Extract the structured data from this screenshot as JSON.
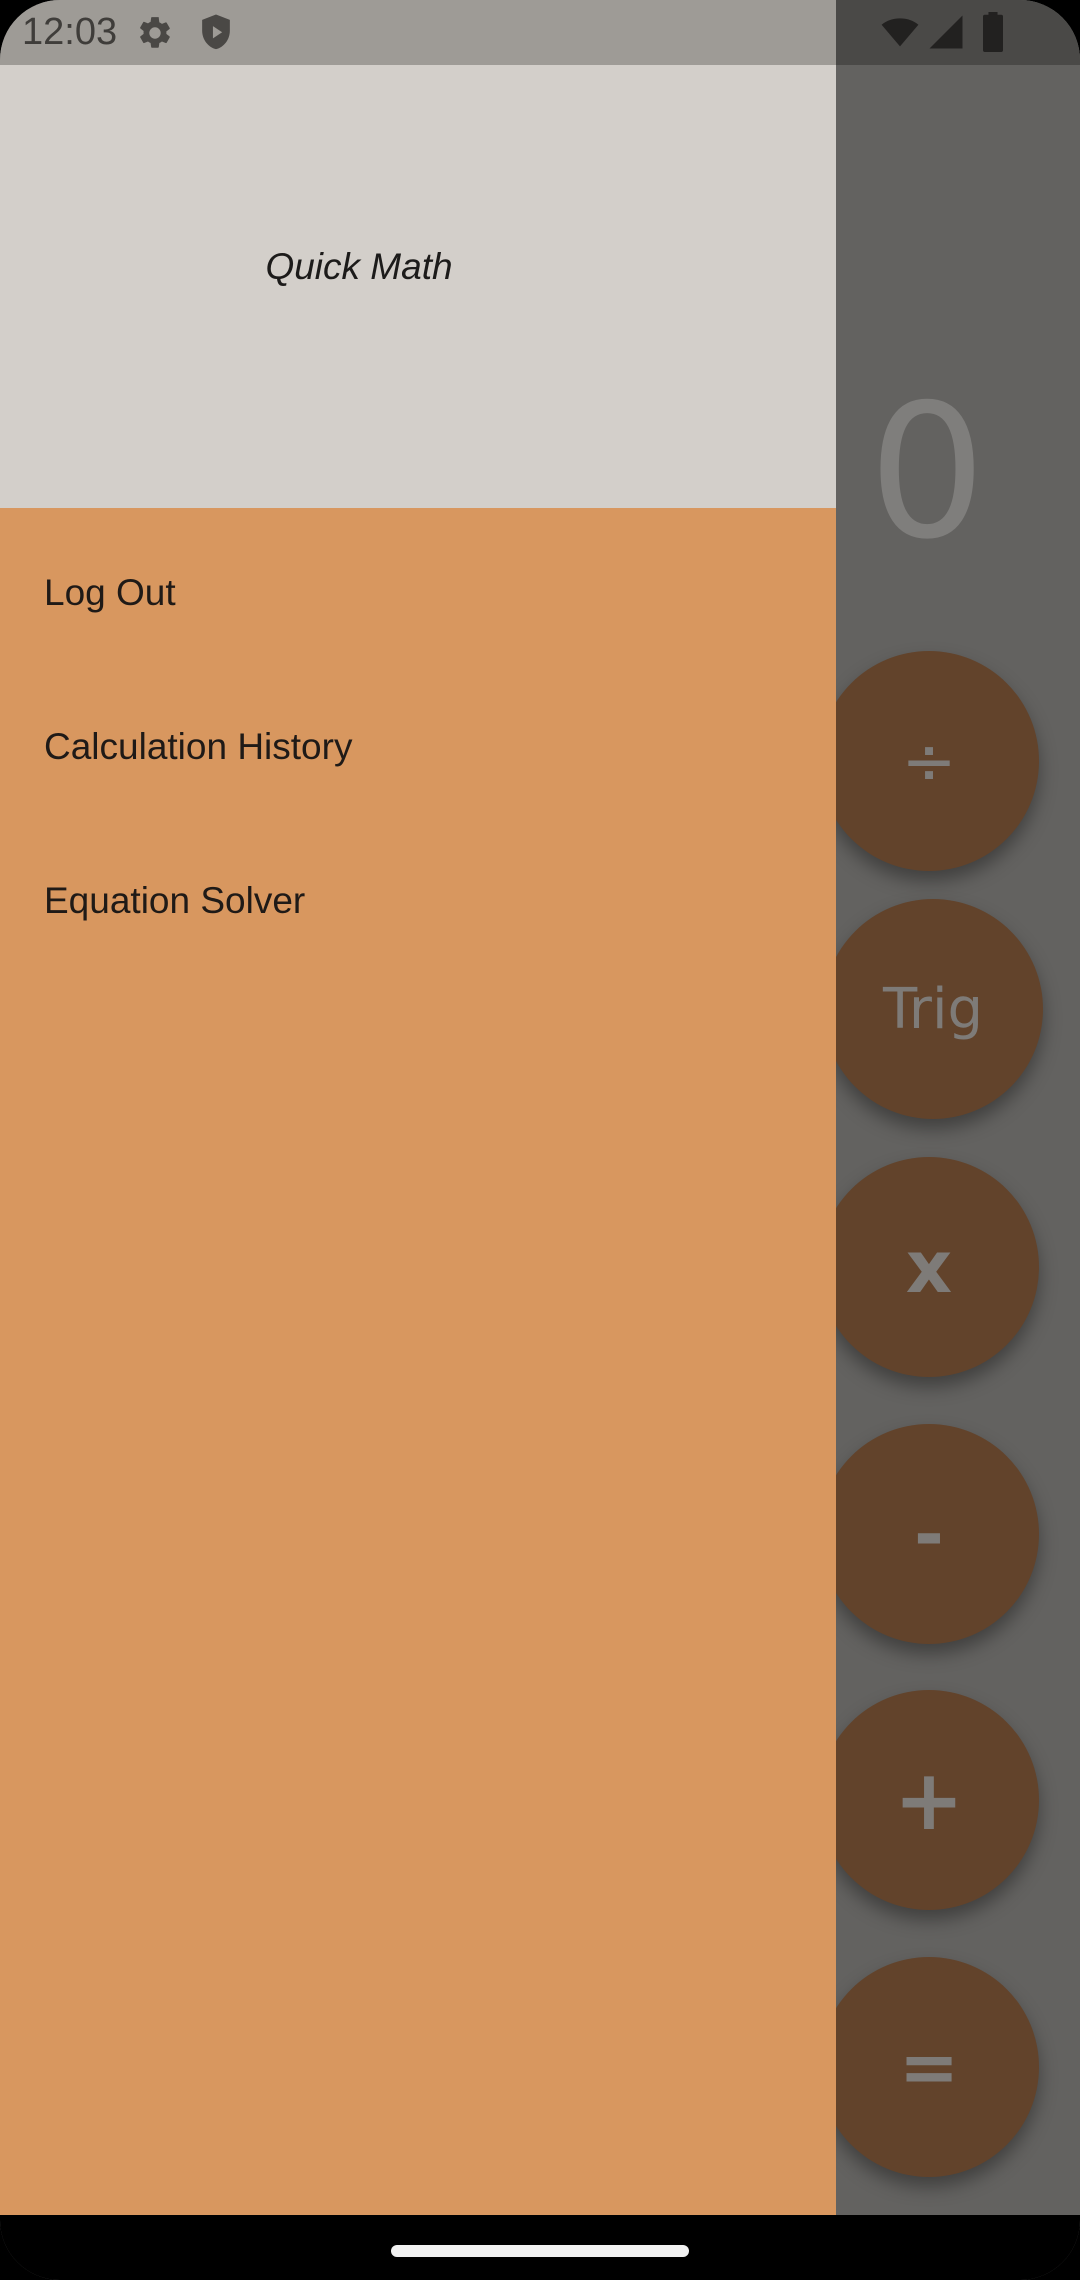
{
  "status_bar": {
    "time": "12:03",
    "icons": [
      "settings-icon",
      "shield-icon",
      "wifi-icon",
      "signal-icon",
      "battery-icon"
    ]
  },
  "drawer": {
    "title": "Quick Math",
    "items": [
      {
        "label": "Log Out"
      },
      {
        "label": "Calculation History"
      },
      {
        "label": "Equation Solver"
      }
    ]
  },
  "calculator": {
    "display": "0",
    "buttons": [
      "÷",
      "Trig",
      "x",
      "-",
      "+",
      "="
    ]
  },
  "colors": {
    "drawer_background": "#d8975f",
    "drawer_header": "#d3cfca",
    "scrim": "#626160",
    "button": "#62432b"
  }
}
